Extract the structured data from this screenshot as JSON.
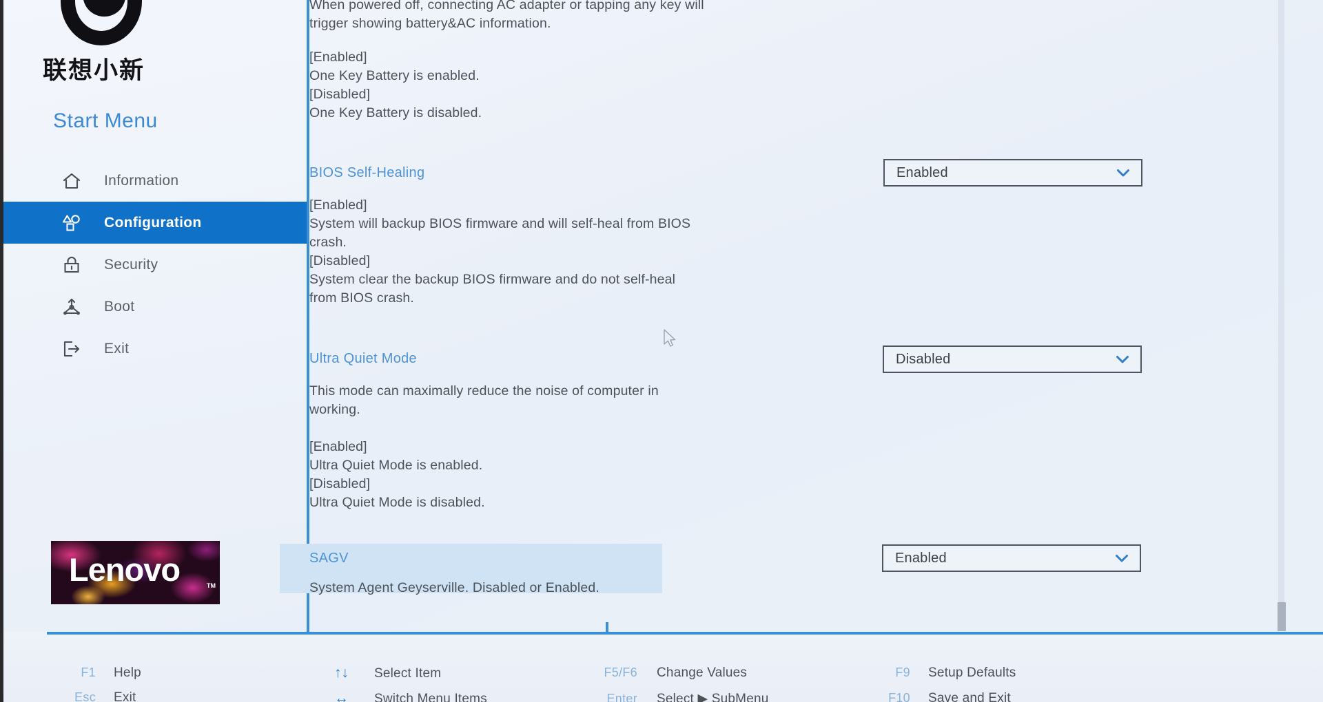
{
  "brand": {
    "mascot_icon": "lenovo-xiaoxin-mascot-icon",
    "chinese_name": "联想小新",
    "start_menu_title": "Start Menu",
    "logo_text": "Lenovo",
    "logo_tm": "TM"
  },
  "sidebar": {
    "items": [
      {
        "label": "Information",
        "icon": "home-icon",
        "active": false
      },
      {
        "label": "Configuration",
        "icon": "shapes-icon",
        "active": true
      },
      {
        "label": "Security",
        "icon": "lock-icon",
        "active": false
      },
      {
        "label": "Boot",
        "icon": "boot-icon",
        "active": false
      },
      {
        "label": "Exit",
        "icon": "exit-icon",
        "active": false
      }
    ]
  },
  "colors": {
    "accent_blue": "#1071c8",
    "title_blue": "#4d93d6",
    "divider_blue": "#3a8ed4",
    "highlight_band": "#cfe3f5",
    "body_text": "#4d5258",
    "page_bg": "#eef2f9"
  },
  "content": {
    "partial_top_text": "When powered off, connecting AC adapter or tapping any key will\ntrigger showing battery&AC information.",
    "one_key_battery_states": "[Enabled]\nOne Key Battery is enabled.\n[Disabled]\nOne Key Battery is disabled.",
    "settings": [
      {
        "title": "BIOS Self-Healing",
        "description": "[Enabled]\nSystem will backup BIOS firmware and will self-heal from BIOS\ncrash.\n[Disabled]\nSystem clear the backup BIOS firmware and do not self-heal\nfrom BIOS crash.",
        "value": "Enabled",
        "highlighted": false
      },
      {
        "title": "Ultra Quiet Mode",
        "description": "This mode can maximally reduce the noise of computer in\nworking.\n\n[Enabled]\nUltra Quiet Mode is enabled.\n[Disabled]\nUltra Quiet Mode is disabled.",
        "value": "Disabled",
        "highlighted": false
      },
      {
        "title": "SAGV",
        "description": "System Agent Geyserville. Disabled or Enabled.",
        "value": "Enabled",
        "highlighted": true
      }
    ]
  },
  "helpbar": {
    "entries": [
      {
        "key": "F1",
        "desc": "Help",
        "glyph": ""
      },
      {
        "key": "Esc",
        "desc": "Exit",
        "glyph": ""
      },
      {
        "key": "",
        "desc": "Select Item",
        "glyph": "↑↓"
      },
      {
        "key": "",
        "desc": "Switch Menu Items",
        "glyph": "↔"
      },
      {
        "key": "F5/F6",
        "desc": "Change Values",
        "glyph": ""
      },
      {
        "key": "Enter",
        "desc": "Select ▶ SubMenu",
        "glyph": ""
      },
      {
        "key": "F9",
        "desc": "Setup Defaults",
        "glyph": ""
      },
      {
        "key": "F10",
        "desc": "Save and Exit",
        "glyph": ""
      }
    ]
  },
  "scrollbar": {
    "position_label": "near-bottom"
  }
}
